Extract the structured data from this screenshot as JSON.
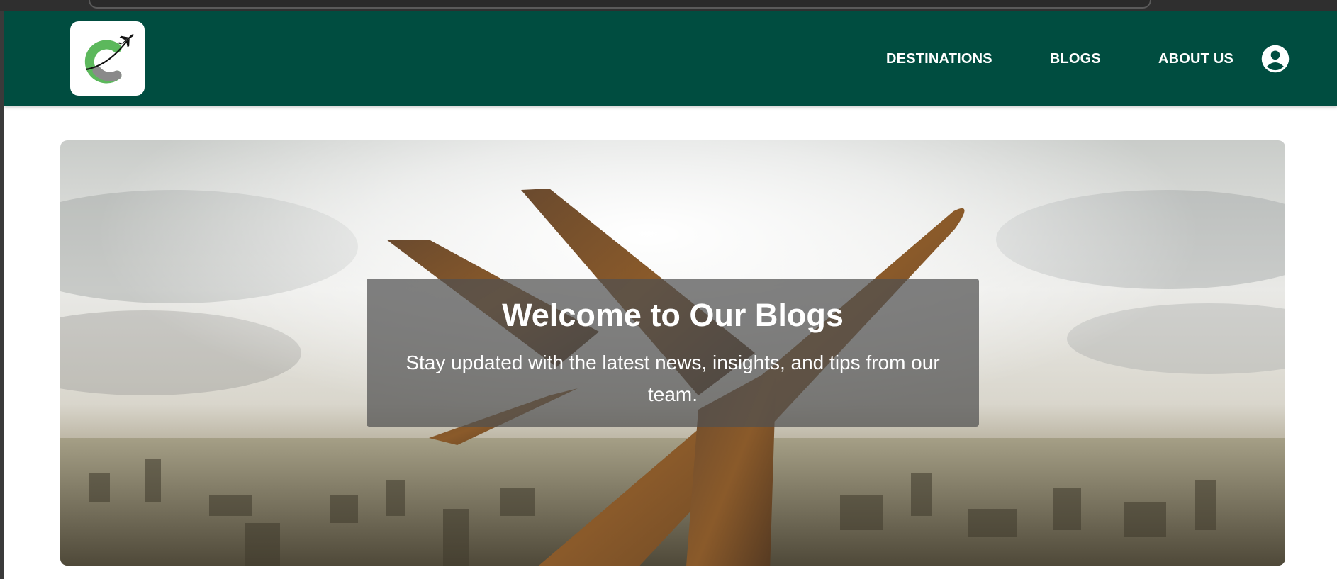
{
  "colors": {
    "brand": "#004d40",
    "logo_green": "#5cb85c",
    "logo_gray": "#8a8a8a"
  },
  "header": {
    "logo_icon": "airplane-c-logo",
    "nav": [
      {
        "label": "DESTINATIONS"
      },
      {
        "label": "BLOGS"
      },
      {
        "label": "ABOUT US"
      }
    ],
    "user_icon": "account-circle-icon"
  },
  "hero": {
    "image": "airplane-over-city",
    "title": "Welcome to Our Blogs",
    "subtitle": "Stay updated with the latest news, insights, and tips from our team."
  }
}
